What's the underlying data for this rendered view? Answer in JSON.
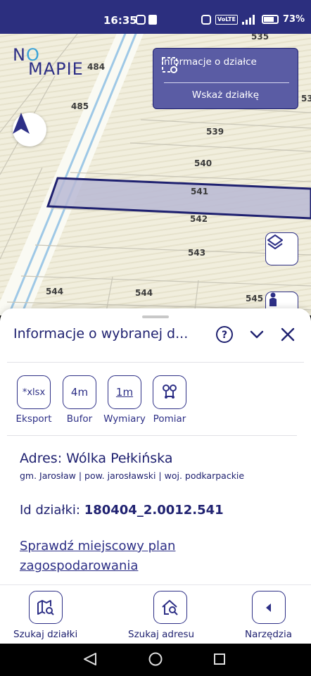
{
  "status": {
    "time": "16:35",
    "battery": "73%",
    "volte": "VoLTE"
  },
  "map": {
    "logo_text_1": "N",
    "logo_text_o": "O",
    "logo_text_2": "MAPIE",
    "parcel_labels": [
      {
        "text": "535"
      },
      {
        "text": "484"
      },
      {
        "text": "485"
      },
      {
        "text": "539"
      },
      {
        "text": "540"
      },
      {
        "text": "541"
      },
      {
        "text": "542"
      },
      {
        "text": "543"
      },
      {
        "text": "544"
      },
      {
        "text": "544"
      },
      {
        "text": "545"
      },
      {
        "text": "53"
      }
    ],
    "selected_parcel": "541"
  },
  "info_panel": {
    "title": "Informacje o działce",
    "action": "Wskaż działkę"
  },
  "sheet": {
    "title": "Informacje o wybranej d...",
    "tools": [
      {
        "icon_text": "*xlsx",
        "label": "Eksport"
      },
      {
        "icon_text": "4m",
        "label": "Bufor"
      },
      {
        "icon_text": "1m",
        "label": "Wymiary"
      },
      {
        "icon_text": "",
        "label": "Pomiar"
      }
    ],
    "address_title": "Adres: Wólka Pełkińska",
    "address_sub": "gm. Jarosław | pow. jarosławski | woj. podkarpackie",
    "id_label": "Id działki: ",
    "id_value": "180404_2.0012.541",
    "plan_link_line1": "Sprawdź miejscowy plan",
    "plan_link_line2": "zagospodarowania"
  },
  "bottom_nav": {
    "items": [
      {
        "label": "Szukaj działki"
      },
      {
        "label": "Szukaj adresu"
      },
      {
        "label": "Narzędzia"
      }
    ]
  },
  "colors": {
    "brand": "#2d2f86",
    "status_bar": "#2c2f7f",
    "map_bg": "#f1eedd",
    "panel": "#5a5ca4"
  }
}
